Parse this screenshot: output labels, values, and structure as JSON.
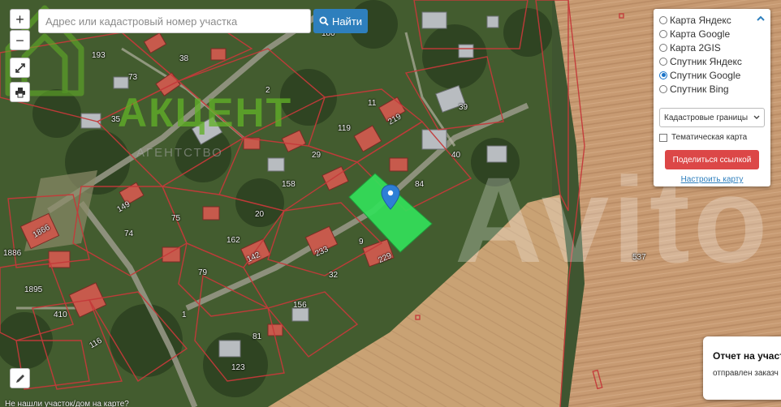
{
  "search": {
    "placeholder": "Адрес или кадастровый номер участка",
    "button_label": "Найти"
  },
  "controls": {
    "zoom_in": "+",
    "zoom_out": "−"
  },
  "layers": {
    "options": [
      {
        "label": "Карта Яндекс",
        "checked": false
      },
      {
        "label": "Карта Google",
        "checked": false
      },
      {
        "label": "Карта 2GIS",
        "checked": false
      },
      {
        "label": "Спутник Яндекс",
        "checked": false
      },
      {
        "label": "Спутник Google",
        "checked": true
      },
      {
        "label": "Спутник Bing",
        "checked": false
      }
    ],
    "boundaries_select": "Кадастровые границы",
    "thematic_map_label": "Тематическая карта",
    "share_button": "Поделиться ссылкой",
    "setup_link": "Настроить карту"
  },
  "report": {
    "title": "Отчет на участ",
    "subtitle": "отправлен заказч"
  },
  "bottom_hint": "Не нашли участок/дом на карте?",
  "watermarks": {
    "logo_text": "АКЦЕНТ",
    "logo_sub": "АГЕНТСТВО",
    "avito": "Avito"
  },
  "parcel_numbers": [
    "180",
    "193",
    "38",
    "73",
    "2",
    "11",
    "39",
    "35",
    "119",
    "29",
    "40",
    "158",
    "84",
    "75",
    "74",
    "20",
    "162",
    "79",
    "9",
    "32",
    "1886",
    "1895",
    "410",
    "156",
    "81",
    "123",
    "1",
    "537",
    "1866",
    "229",
    "149",
    "219",
    "116",
    "142",
    "233"
  ],
  "colors": {
    "selected_parcel": "#33e05a",
    "parcel_border": "#c43a3a",
    "accent_blue": "#2e7fbd",
    "share_red": "#dc4747",
    "marker_blue": "#2e7fd6"
  }
}
